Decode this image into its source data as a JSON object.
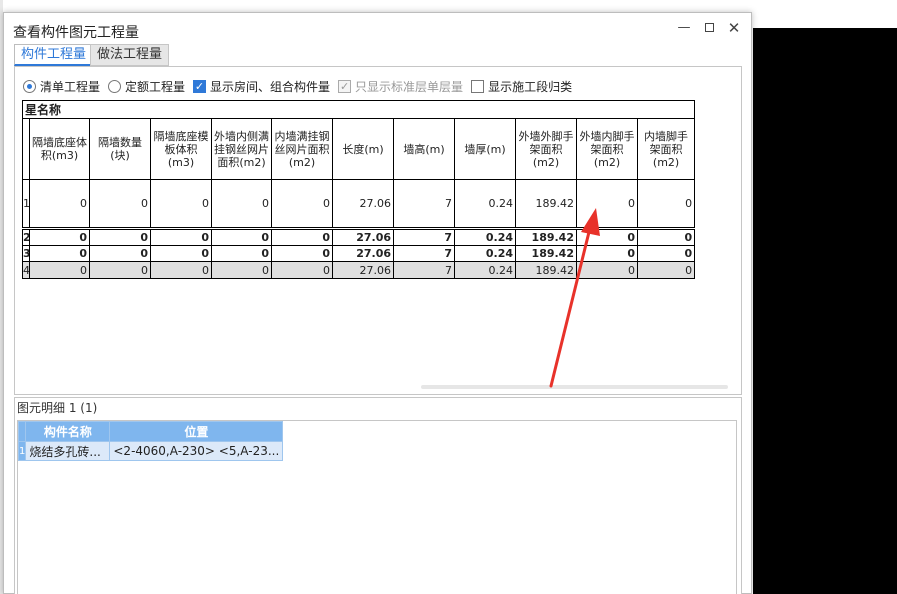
{
  "window": {
    "title": "查看构件图元工程量",
    "minimize": "—",
    "close": "✕"
  },
  "tabs": [
    {
      "label": "构件工程量",
      "active": true
    },
    {
      "label": "做法工程量",
      "active": false
    }
  ],
  "options": [
    {
      "label": "清单工程量",
      "type": "radio",
      "checked": true
    },
    {
      "label": "定额工程量",
      "type": "radio",
      "checked": false
    },
    {
      "label": "显示房间、组合构件量",
      "type": "checkbox",
      "checked": true
    },
    {
      "label": "只显示标准层单层量",
      "type": "checkbox",
      "checked": true,
      "disabled": true
    },
    {
      "label": "显示施工段归类",
      "type": "checkbox",
      "checked": false
    }
  ],
  "grid": {
    "name_header": "星名称",
    "columns": [
      "隔墙底座体积(m3)",
      "隔墙数量(块)",
      "隔墙底座模板体积(m3)",
      "外墙内侧满挂钢丝网片面积(m2)",
      "内墙满挂钢丝网片面积(m2)",
      "长度(m)",
      "墙高(m)",
      "墙厚(m)",
      "外墙外脚手架面积(m2)",
      "外墙内脚手架面积(m2)",
      "内墙脚手架面积(m2)"
    ],
    "rows": [
      {
        "num": "1",
        "cells": [
          "0",
          "0",
          "0",
          "0",
          "0",
          "27.06",
          "7",
          "0.24",
          "189.42",
          "0",
          "0"
        ]
      },
      {
        "num": "2",
        "cells": [
          "0",
          "0",
          "0",
          "0",
          "0",
          "27.06",
          "7",
          "0.24",
          "189.42",
          "0",
          "0"
        ]
      },
      {
        "num": "3",
        "cells": [
          "0",
          "0",
          "0",
          "0",
          "0",
          "27.06",
          "7",
          "0.24",
          "189.42",
          "0",
          "0"
        ]
      },
      {
        "num": "4",
        "cells": [
          "0",
          "0",
          "0",
          "0",
          "0",
          "27.06",
          "7",
          "0.24",
          "189.42",
          "0",
          "0"
        ]
      }
    ]
  },
  "detail": {
    "label": "图元明细  1 (1)",
    "columns": [
      "构件名称",
      "位置"
    ],
    "rows": [
      {
        "num": "1",
        "cells": [
          "烧结多孔砖...",
          "<2-4060,A-230> <5,A-23..."
        ]
      }
    ]
  },
  "colors": {
    "accent": "#2f79d8",
    "arrow": "#e8322a",
    "detail_header": "#7fb6ee"
  }
}
